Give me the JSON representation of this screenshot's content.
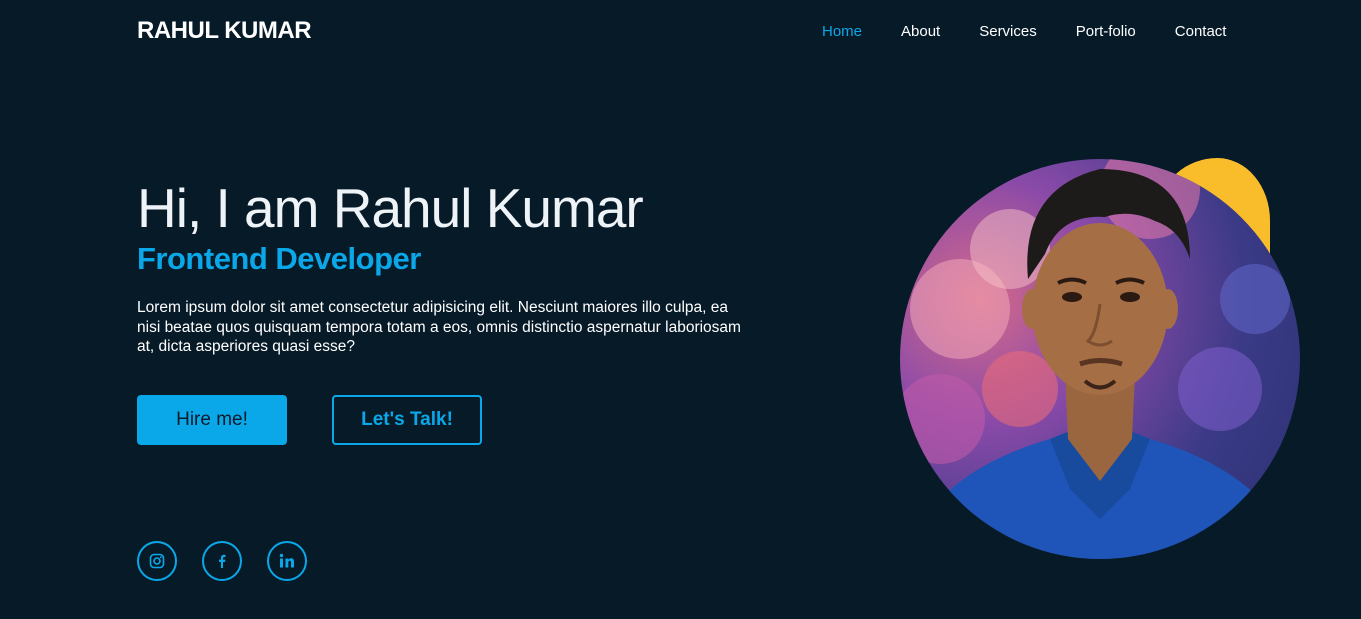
{
  "header": {
    "logo": "RAHUL KUMAR",
    "nav": [
      {
        "label": "Home",
        "active": true
      },
      {
        "label": "About"
      },
      {
        "label": "Services"
      },
      {
        "label": "Port-folio"
      },
      {
        "label": "Contact"
      }
    ]
  },
  "hero": {
    "title": "Hi, I am Rahul Kumar",
    "subtitle": "Frontend Developer",
    "description": "Lorem ipsum dolor sit amet consectetur adipisicing elit. Nesciunt maiores illo culpa, ea nisi beatae quos quisquam tempora totam a eos, omnis distinctio aspernatur laboriosam at, dicta asperiores quasi esse?",
    "primary_button": "Hire me!",
    "secondary_button": "Let's Talk!"
  },
  "social": [
    {
      "icon": "instagram-icon"
    },
    {
      "icon": "facebook-icon"
    },
    {
      "icon": "linkedin-icon"
    }
  ],
  "portrait": {
    "icon": "profile-photo"
  },
  "colors": {
    "background": "#071a28",
    "accent": "#0aa8e8",
    "blob": "#f9bd2c"
  }
}
